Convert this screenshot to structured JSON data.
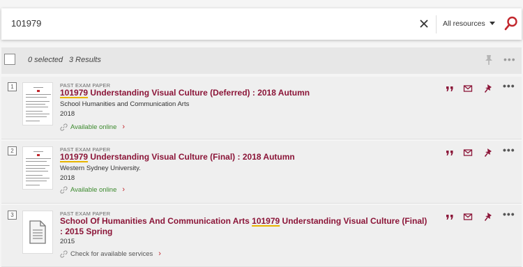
{
  "search": {
    "query": "101979",
    "scope_label": "All resources"
  },
  "toolbar": {
    "selected_label": "0 selected",
    "results_label": "3 Results"
  },
  "results": [
    {
      "index": "1",
      "type": "PAST EXAM PAPER",
      "title_highlight": "101979",
      "title_rest": " Understanding Visual Culture (Deferred) : 2018 Autumn",
      "line1": "School Humanities and Communication Arts",
      "line2": "2018",
      "availability": "Available online"
    },
    {
      "index": "2",
      "type": "PAST EXAM PAPER",
      "title_highlight": "101979",
      "title_rest": " Understanding Visual Culture (Final) : 2018 Autumn",
      "line1": "Western Sydney University.",
      "line2": "2018",
      "availability": "Available online"
    },
    {
      "index": "3",
      "type": "PAST EXAM PAPER",
      "title_prefix": "School Of Humanities And Communication Arts ",
      "title_highlight": "101979",
      "title_rest": " Understanding Visual Culture (Final) : 2015 Spring",
      "line1": "2015",
      "availability": "Check for available services"
    }
  ],
  "colors": {
    "accent": "#8b1538",
    "available": "#3c8a2e",
    "highlight_underline": "#e8b400",
    "chevron": "#c2272d"
  },
  "icons": [
    "clear-icon",
    "dropdown-caret-icon",
    "search-icon",
    "pin-icon",
    "more-icon",
    "quote-icon",
    "mail-icon",
    "link-icon",
    "document-icon"
  ]
}
